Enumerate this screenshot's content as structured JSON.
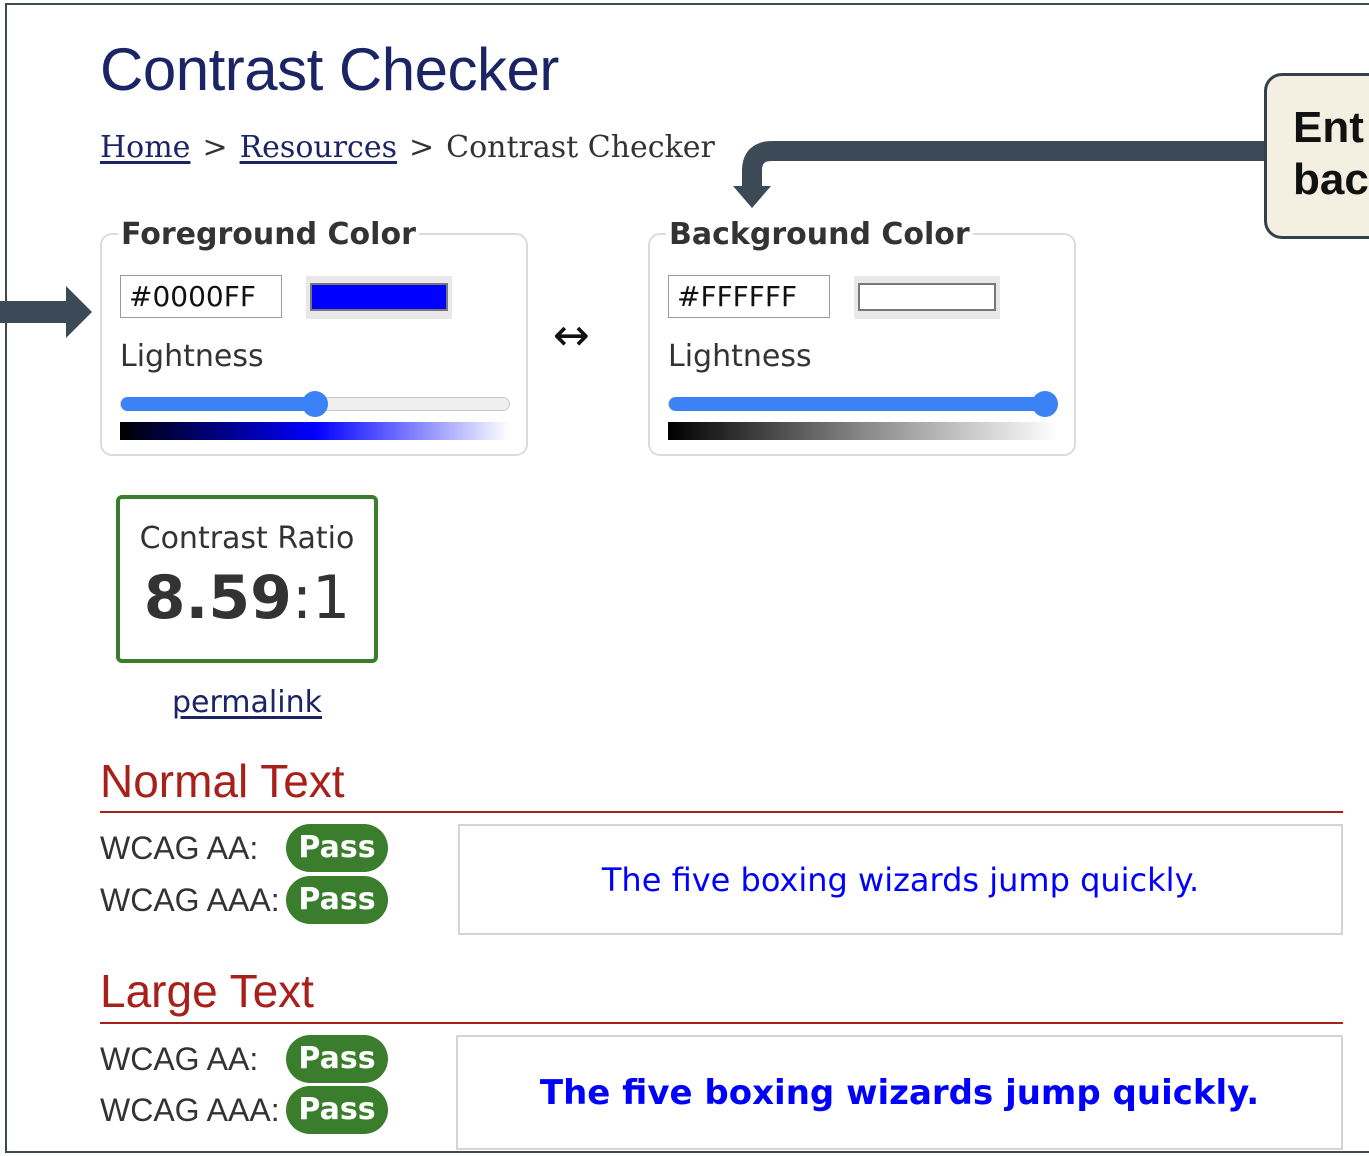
{
  "page": {
    "title": "Contrast Checker",
    "breadcrumb": {
      "home": "Home",
      "resources": "Resources",
      "current": "Contrast Checker",
      "sep": ">"
    }
  },
  "callout": {
    "line1": "Ent",
    "line2": "bac"
  },
  "foreground": {
    "legend": "Foreground Color",
    "hex": "#0000FF",
    "swatch_color": "#0000FF",
    "lightness_label": "Lightness",
    "lightness_percent": 50
  },
  "background": {
    "legend": "Background Color",
    "hex": "#FFFFFF",
    "swatch_color": "#FFFFFF",
    "lightness_label": "Lightness",
    "lightness_percent": 100
  },
  "swap_icon": "swap-arrows-icon",
  "swap_glyph": "↔",
  "contrast": {
    "label": "Contrast Ratio",
    "ratio_bold": "8.59",
    "ratio_rest": ":1"
  },
  "permalink": "permalink",
  "normal_text": {
    "heading": "Normal Text",
    "aa_label": "WCAG AA:",
    "aa_result": "Pass",
    "aaa_label": "WCAG AAA:",
    "aaa_result": "Pass",
    "sample": "The five boxing wizards jump quickly."
  },
  "large_text": {
    "heading": "Large Text",
    "aa_label": "WCAG AA:",
    "aa_result": "Pass",
    "aaa_label": "WCAG AAA:",
    "aaa_result": "Pass",
    "sample": "The five boxing wizards jump quickly."
  },
  "colors": {
    "pass": "#3A7D2C",
    "heading_red": "#A8201A",
    "title_navy": "#1B2566",
    "slider_blue": "#3B82F6"
  }
}
